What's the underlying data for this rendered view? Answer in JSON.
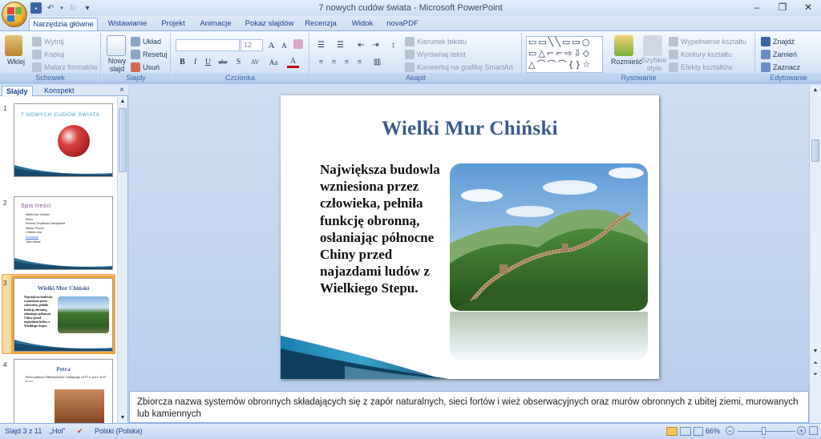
{
  "window": {
    "title": "7 nowych cudów świata - Microsoft PowerPoint",
    "minimize": "–",
    "restore": "❐",
    "close": "✕"
  },
  "qat": {
    "save": "💾",
    "undo": "↶",
    "redo": "↻",
    "more": "▾"
  },
  "tabs": [
    "Narzędzia główne",
    "Wstawianie",
    "Projekt",
    "Animacje",
    "Pokaz slajdów",
    "Recenzja",
    "Widok",
    "novaPDF"
  ],
  "ribbon": {
    "clipboard": {
      "label": "Schowek",
      "paste": "Wklej",
      "cut": "Wytnij",
      "copy": "Kopiuj",
      "format_painter": "Malarz formatów"
    },
    "slides": {
      "label": "Slajdy",
      "new_slide": "Nowy slajd",
      "layout": "Układ",
      "reset": "Resetuj",
      "delete": "Usuń"
    },
    "font": {
      "label": "Czcionka",
      "size": "12",
      "grow": "A",
      "shrink": "A",
      "bold": "B",
      "italic": "I",
      "underline": "U",
      "strike": "abe",
      "shadow": "S",
      "spacing": "AV",
      "case": "Aa",
      "color": "A"
    },
    "paragraph": {
      "label": "Akapit",
      "text_direction": "Kierunek tekstu",
      "align_text": "Wyrównaj tekst",
      "smartart": "Konwertuj na grafikę SmartArt"
    },
    "drawing": {
      "label": "Rysowanie",
      "arrange": "Rozmieść",
      "quick_styles": "Szybkie style",
      "fill": "Wypełnienie kształtu",
      "outline": "Kontury kształtu",
      "effects": "Efekty kształtów"
    },
    "editing": {
      "label": "Edytowanie",
      "find": "Znajdź",
      "replace": "Zamień",
      "select": "Zaznacz"
    }
  },
  "pane": {
    "tab_slides": "Slajdy",
    "tab_outline": "Konspekt",
    "close": "×",
    "thumbs": [
      {
        "num": "1",
        "title": "7 NOWYCH CUDÓW ŚWIATA"
      },
      {
        "num": "2",
        "title": "Spis treści",
        "items": [
          "Wielki Mur Chiński",
          "Petra",
          "Pomnik Chrystusa Odkupiciela",
          "Machu Picchu",
          "Chichen Itza",
          "Koloseum",
          "Tadż Mahal"
        ]
      },
      {
        "num": "3",
        "title": "Wielki Mur Chiński",
        "body": "Największa budowla wzniesiona przez człowieka, pełniła funkcję obronną, osłaniając północne Chiny przed najazdami ludów z Wielkiego Stepu."
      },
      {
        "num": "4",
        "title": "Petra",
        "body": "Stolica państwa Nabatejczyków, istniejącego od IV w. p.n.e. do II w. n.e."
      }
    ]
  },
  "slide": {
    "title": "Wielki Mur Chiński",
    "body": "Największa budowla wzniesiona przez człowieka, pełniła funkcję obronną, osłaniając północne Chiny przed najazdami ludów z Wielkiego Stepu."
  },
  "notes": "Zbiorcza nazwa systemów obronnych składających się z zapór naturalnych, sieci fortów i wież obserwacyjnych oraz murów obronnych z ubitej ziemi, murowanych lub kamiennych",
  "status": {
    "slide_counter": "Slajd 3 z 11",
    "theme": "„Hol”",
    "language": "Polski (Polska)",
    "zoom": "66%",
    "minus": "−",
    "plus": "+"
  },
  "colors": {
    "accent": "#f5a63c",
    "title_blue": "#3a5a8c",
    "ribbon_label": "#3e6aaa"
  }
}
